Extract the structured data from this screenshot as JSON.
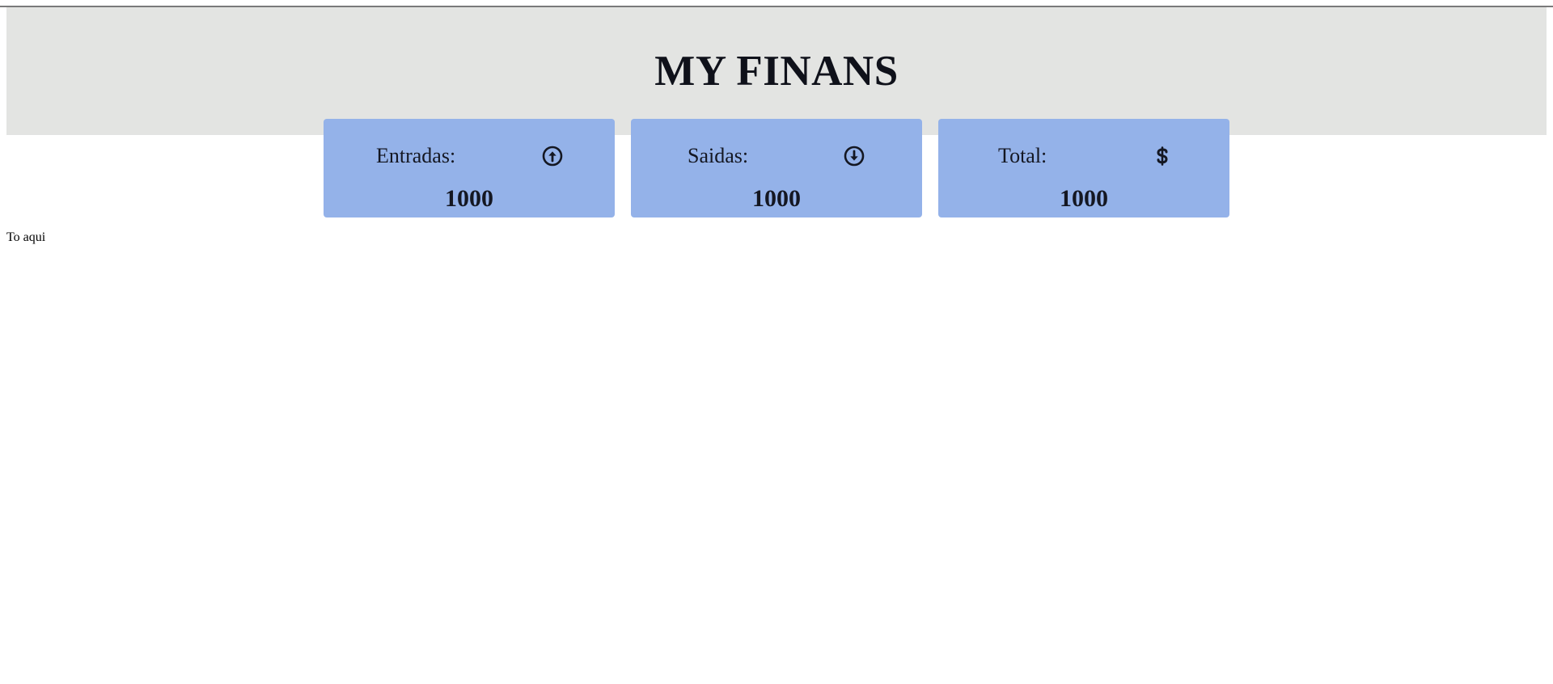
{
  "header": {
    "title": "MY FINANS"
  },
  "summary": {
    "cards": [
      {
        "label": "Entradas:",
        "value": "1000",
        "icon": "arrow-up-circle-icon"
      },
      {
        "label": "Saidas:",
        "value": "1000",
        "icon": "arrow-down-circle-icon"
      },
      {
        "label": "Total:",
        "value": "1000",
        "icon": "dollar-sign-icon"
      }
    ]
  },
  "main": {
    "note": "To aqui"
  },
  "colors": {
    "header_background": "#e3e4e2",
    "card_background": "#94b2e9",
    "title_text": "#0f111a"
  }
}
